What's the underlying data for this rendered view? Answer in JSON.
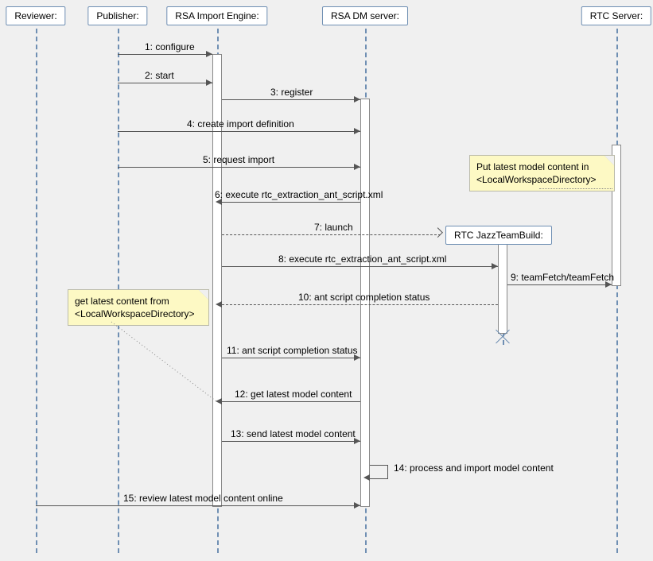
{
  "participants": {
    "reviewer": "Reviewer:",
    "publisher": "Publisher:",
    "import_engine": "RSA Import Engine:",
    "dm_server": "RSA DM server:",
    "rtc_server": "RTC Server:",
    "jazz_build": "RTC JazzTeamBuild:"
  },
  "messages": {
    "m1": "1: configure",
    "m2": "2: start",
    "m3": "3: register",
    "m4": "4: create import definition",
    "m5": "5: request import",
    "m6": "6: execute rtc_extraction_ant_script.xml",
    "m7": "7: launch",
    "m8": "8: execute rtc_extraction_ant_script.xml",
    "m9": "9: teamFetch/teamFetch",
    "m10": "10: ant script completion status",
    "m11": "11: ant script completion status",
    "m12": "12: get latest model content",
    "m13": "13: send latest model content",
    "m14": "14: process and import model content",
    "m15": "15: review latest model content online"
  },
  "notes": {
    "n1_line1": "Put latest model content in",
    "n1_line2": "<LocalWorkspaceDirectory>",
    "n2_line1": "get latest content from",
    "n2_line2": "<LocalWorkspaceDirectory>"
  }
}
